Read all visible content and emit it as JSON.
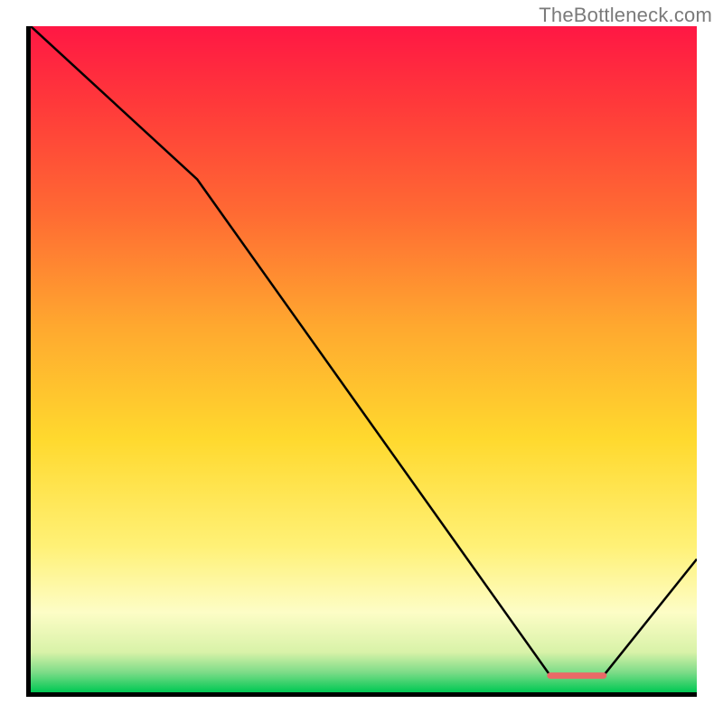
{
  "watermark": "TheBottleneck.com",
  "chart_data": {
    "type": "line",
    "title": "",
    "xlabel": "",
    "ylabel": "",
    "xlim": [
      0,
      100
    ],
    "ylim": [
      0,
      100
    ],
    "gradient_stops": [
      {
        "offset": 0,
        "color": "#ff1744"
      },
      {
        "offset": 12,
        "color": "#ff3a3a"
      },
      {
        "offset": 28,
        "color": "#ff6a33"
      },
      {
        "offset": 45,
        "color": "#ffa82f"
      },
      {
        "offset": 62,
        "color": "#ffd92e"
      },
      {
        "offset": 78,
        "color": "#fff176"
      },
      {
        "offset": 88,
        "color": "#fdfdc6"
      },
      {
        "offset": 94,
        "color": "#d8f2a8"
      },
      {
        "offset": 97,
        "color": "#7ddc88"
      },
      {
        "offset": 100,
        "color": "#00c853"
      }
    ],
    "series": [
      {
        "name": "curve",
        "x": [
          0,
          25,
          78,
          80,
          86,
          100
        ],
        "y": [
          100,
          77,
          2.5,
          2.5,
          2.5,
          20
        ]
      }
    ],
    "marker": {
      "name": "optimal-range",
      "x_start": 78,
      "x_end": 86,
      "y": 2.5,
      "color": "#e96a67",
      "thickness": 1.2
    }
  }
}
